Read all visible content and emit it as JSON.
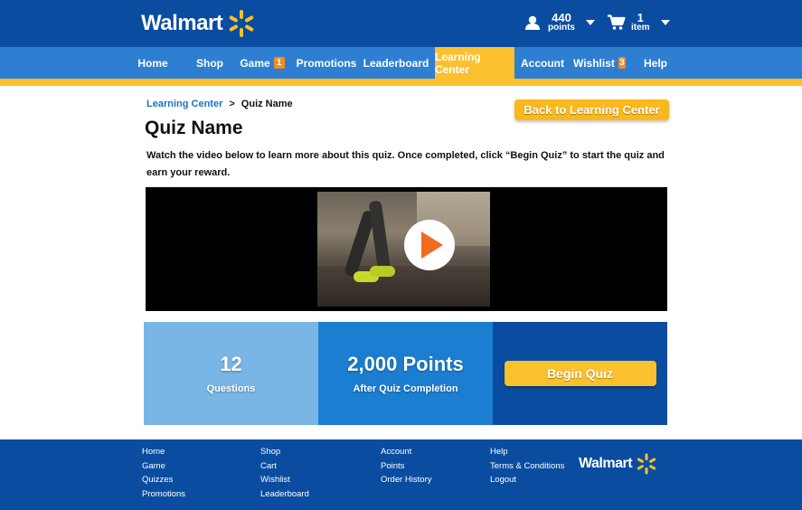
{
  "header": {
    "brand": "Walmart",
    "points_value": "440",
    "points_label": "points",
    "cart_count": "1",
    "cart_label": "item"
  },
  "nav": {
    "items": [
      {
        "label": "Home"
      },
      {
        "label": "Shop"
      },
      {
        "label": "Game",
        "badge": "1"
      },
      {
        "label": "Promotions"
      },
      {
        "label": "Leaderboard"
      },
      {
        "label": "Learning Center"
      },
      {
        "label": "Account"
      },
      {
        "label": "Wishlist",
        "badge": "3"
      },
      {
        "label": "Help"
      }
    ]
  },
  "breadcrumb": {
    "parent": "Learning Center",
    "separator": ">",
    "current": "Quiz Name"
  },
  "page": {
    "back_button": "Back to Learning Center",
    "title": "Quiz Name",
    "description": "Watch the video below to learn more about this quiz. Once completed, click “Begin Quiz” to start the quiz and earn your reward."
  },
  "stats": {
    "questions_value": "12",
    "questions_label": "Questions",
    "points_value": "2,000 Points",
    "points_label": "After Quiz Completion",
    "begin_button": "Begin Quiz"
  },
  "footer": {
    "col1": [
      "Home",
      "Game",
      "Quizzes",
      "Promotions"
    ],
    "col2": [
      "Shop",
      "Cart",
      "Wishlist",
      "Leaderboard"
    ],
    "col3": [
      "Account",
      "Points",
      "Order History"
    ],
    "col4": [
      "Help",
      "Terms & Conditions",
      "Logout"
    ],
    "brand": "Walmart"
  },
  "colors": {
    "header_blue": "#0a4da0",
    "nav_blue": "#2e7fd2",
    "accent_yellow": "#fbc02d",
    "badge_orange": "#f68b1f",
    "play_orange": "#f26a20"
  }
}
